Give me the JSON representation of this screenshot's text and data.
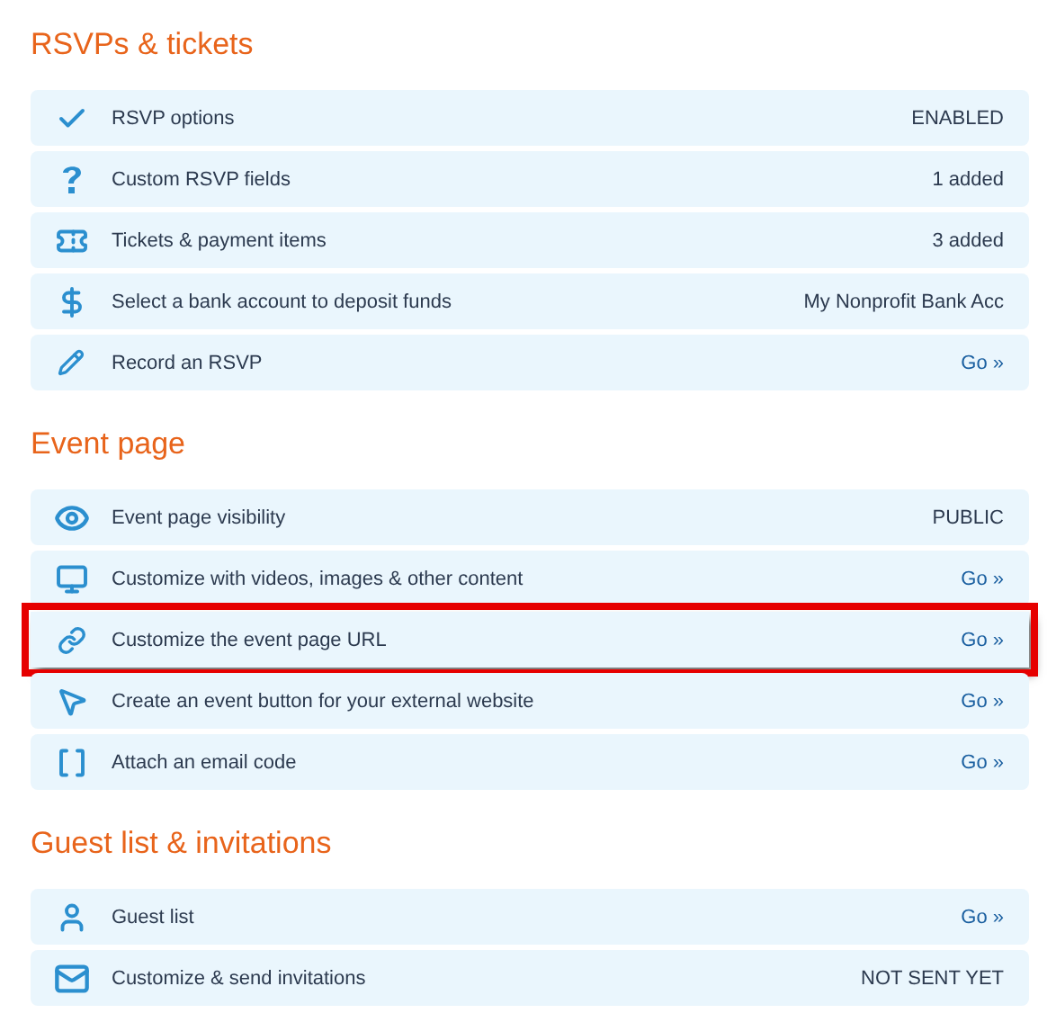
{
  "sections": [
    {
      "title": "RSVPs & tickets",
      "rows": [
        {
          "label": "RSVP options",
          "value": "ENABLED",
          "kind": "status",
          "highlighted": false
        },
        {
          "label": "Custom RSVP fields",
          "value": "1 added",
          "kind": "status",
          "highlighted": false
        },
        {
          "label": "Tickets & payment items",
          "value": "3 added",
          "kind": "status",
          "highlighted": false
        },
        {
          "label": "Select a bank account to deposit funds",
          "value": "My Nonprofit Bank Acc",
          "kind": "status",
          "highlighted": false
        },
        {
          "label": "Record an RSVP",
          "value": "Go »",
          "kind": "link",
          "highlighted": false
        }
      ]
    },
    {
      "title": "Event page",
      "rows": [
        {
          "label": "Event page visibility",
          "value": "PUBLIC",
          "kind": "status",
          "highlighted": false
        },
        {
          "label": "Customize with videos, images & other content",
          "value": "Go »",
          "kind": "link",
          "highlighted": false
        },
        {
          "label": "Customize the event page URL",
          "value": "Go »",
          "kind": "link",
          "highlighted": true
        },
        {
          "label": "Create an event button for your external website",
          "value": "Go »",
          "kind": "link",
          "highlighted": false
        },
        {
          "label": "Attach an email code",
          "value": "Go »",
          "kind": "link",
          "highlighted": false
        }
      ]
    },
    {
      "title": "Guest list & invitations",
      "rows": [
        {
          "label": "Guest list",
          "value": "Go »",
          "kind": "link",
          "highlighted": false
        },
        {
          "label": "Customize & send invitations",
          "value": "NOT SENT YET",
          "kind": "status",
          "highlighted": false
        }
      ]
    }
  ]
}
